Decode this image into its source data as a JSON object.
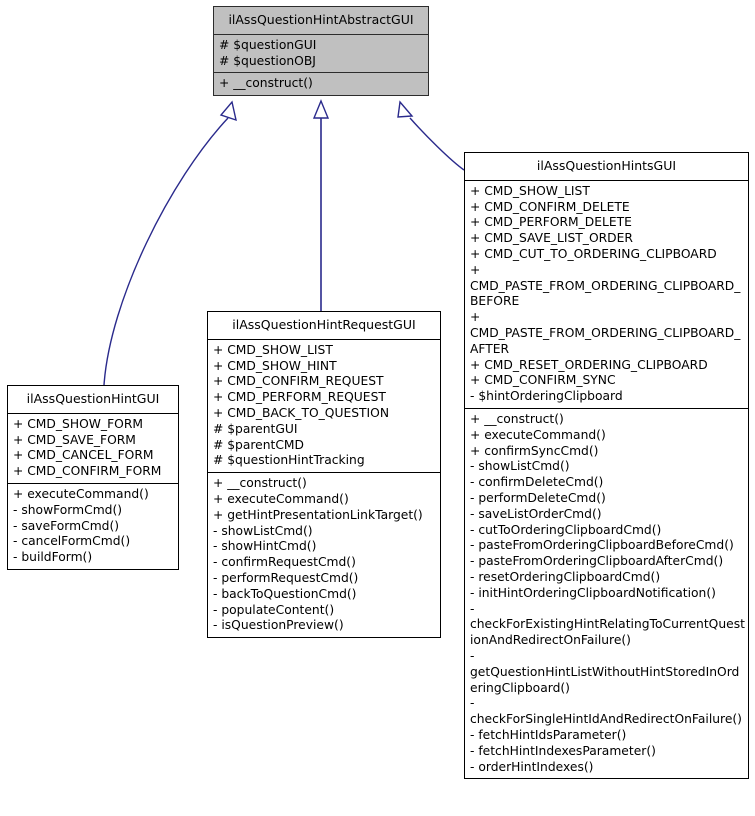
{
  "diagram": {
    "type": "uml-class-inheritance",
    "edge_color": "#2a2a8c",
    "abstract_fill": "#c0c0c0",
    "classes": [
      {
        "id": "abstract",
        "name": "ilAssQuestionHintAbstractGUI",
        "attributes": [
          "# $questionGUI",
          "# $questionOBJ"
        ],
        "operations": [
          "+ __construct()"
        ]
      },
      {
        "id": "hints",
        "name": "ilAssQuestionHintsGUI",
        "attributes": [
          "+ CMD_SHOW_LIST",
          "+ CMD_CONFIRM_DELETE",
          "+ CMD_PERFORM_DELETE",
          "+ CMD_SAVE_LIST_ORDER",
          "+ CMD_CUT_TO_ORDERING_CLIPBOARD",
          "+ CMD_PASTE_FROM_ORDERING_CLIPBOARD_BEFORE",
          "+ CMD_PASTE_FROM_ORDERING_CLIPBOARD_AFTER",
          "+ CMD_RESET_ORDERING_CLIPBOARD",
          "+ CMD_CONFIRM_SYNC",
          "- $hintOrderingClipboard"
        ],
        "operations": [
          "+ __construct()",
          "+ executeCommand()",
          "+ confirmSyncCmd()",
          "- showListCmd()",
          "- confirmDeleteCmd()",
          "- performDeleteCmd()",
          "- saveListOrderCmd()",
          "- cutToOrderingClipboardCmd()",
          "- pasteFromOrderingClipboardBeforeCmd()",
          "- pasteFromOrderingClipboardAfterCmd()",
          "- resetOrderingClipboardCmd()",
          "- initHintOrderingClipboardNotification()",
          "- checkForExistingHintRelatingToCurrentQuestionAndRedirectOnFailure()",
          "- getQuestionHintListWithoutHintStoredInOrderingClipboard()",
          "- checkForSingleHintIdAndRedirectOnFailure()",
          "- fetchHintIdsParameter()",
          "- fetchHintIndexesParameter()",
          "- orderHintIndexes()"
        ]
      },
      {
        "id": "request",
        "name": "ilAssQuestionHintRequestGUI",
        "attributes": [
          "+ CMD_SHOW_LIST",
          "+ CMD_SHOW_HINT",
          "+ CMD_CONFIRM_REQUEST",
          "+ CMD_PERFORM_REQUEST",
          "+ CMD_BACK_TO_QUESTION",
          "# $parentGUI",
          "# $parentCMD",
          "# $questionHintTracking"
        ],
        "operations": [
          "+ __construct()",
          "+ executeCommand()",
          "+ getHintPresentationLinkTarget()",
          "- showListCmd()",
          "- showHintCmd()",
          "- confirmRequestCmd()",
          "- performRequestCmd()",
          "- backToQuestionCmd()",
          "- populateContent()",
          "- isQuestionPreview()"
        ]
      },
      {
        "id": "hint",
        "name": "ilAssQuestionHintGUI",
        "attributes": [
          "+ CMD_SHOW_FORM",
          "+ CMD_SAVE_FORM",
          "+ CMD_CANCEL_FORM",
          "+ CMD_CONFIRM_FORM"
        ],
        "operations": [
          "+ executeCommand()",
          "- showFormCmd()",
          "- saveFormCmd()",
          "- cancelFormCmd()",
          "- buildForm()"
        ]
      }
    ],
    "inheritance_edges": [
      {
        "from": "hint",
        "to": "abstract"
      },
      {
        "from": "request",
        "to": "abstract"
      },
      {
        "from": "hints",
        "to": "abstract"
      }
    ]
  }
}
